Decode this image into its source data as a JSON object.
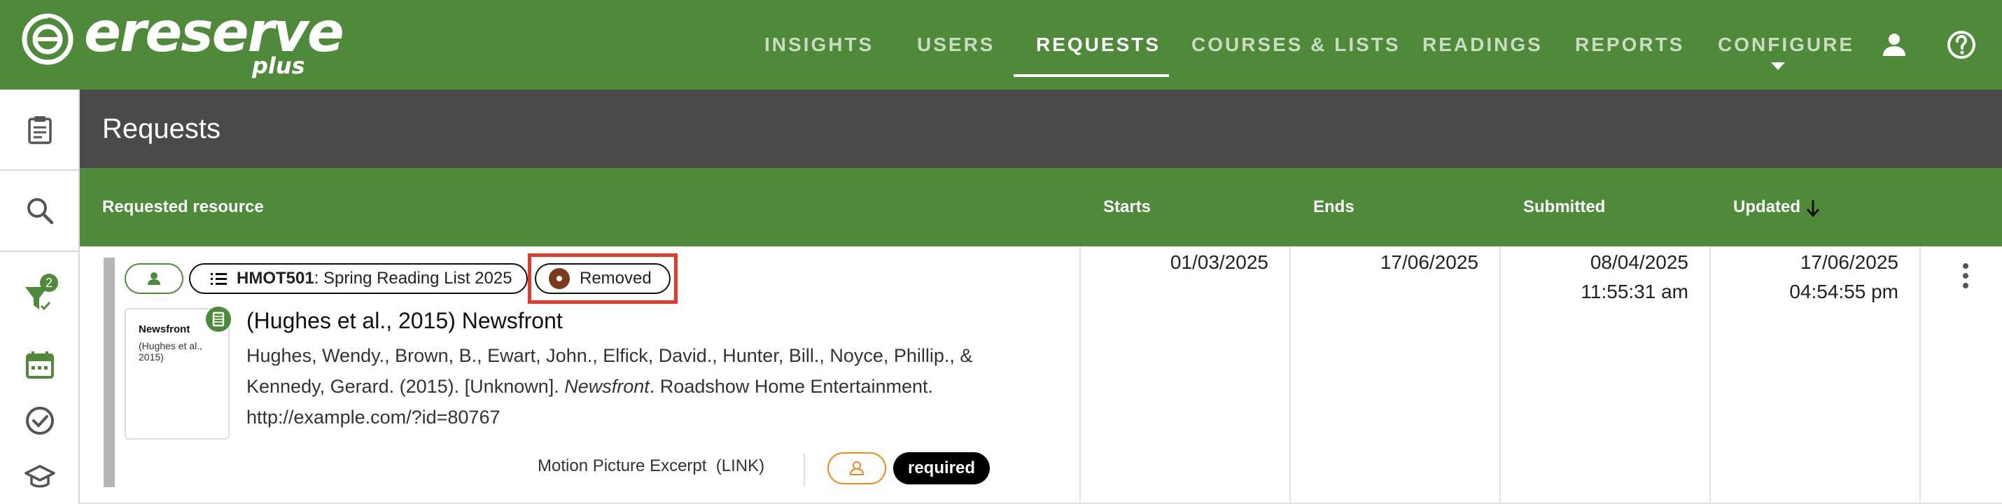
{
  "app": {
    "logo_text": "ereserve",
    "logo_sub": "plus"
  },
  "nav": {
    "items": [
      {
        "label": "INSIGHTS"
      },
      {
        "label": "USERS"
      },
      {
        "label": "REQUESTS",
        "active": true
      },
      {
        "label": "COURSES & LISTS"
      },
      {
        "label": "READINGS"
      },
      {
        "label": "REPORTS"
      },
      {
        "label": "CONFIGURE"
      }
    ],
    "icons": [
      "user-icon",
      "help-icon"
    ]
  },
  "sidebar": {
    "items": [
      {
        "icon": "clipboard-icon"
      },
      {
        "icon": "search-icon"
      },
      {
        "icon": "filter-icon",
        "badge": "2"
      },
      {
        "icon": "calendar-icon"
      },
      {
        "icon": "check-circle-icon"
      },
      {
        "icon": "graduation-cap-icon"
      }
    ]
  },
  "page": {
    "title": "Requests"
  },
  "table": {
    "headers": {
      "resource": "Requested resource",
      "starts": "Starts",
      "ends": "Ends",
      "submitted": "Submitted",
      "updated": "Updated"
    },
    "sort": {
      "column": "updated",
      "direction": "descending"
    },
    "rows": [
      {
        "list_code": "HMOT501",
        "list_name": ": Spring Reading List 2025",
        "status": "Removed",
        "thumb_title": "Newsfront",
        "thumb_sub": "(Hughes et al., 2015)",
        "title": "(Hughes et al., 2015) Newsfront",
        "citation_pre": "Hughes, Wendy., Brown, B., Ewart, John., Elfick, David., Hunter, Bill., Noyce, Phillip., & Kennedy, Gerard. (2015). [Unknown]. ",
        "citation_italic": "Newsfront",
        "citation_post": ". Roadshow Home Entertainment.",
        "url": "http://example.com/?id=80767",
        "resource_type": "Motion Picture Excerpt",
        "link_type": "(LINK)",
        "required_label": "required",
        "starts": "01/03/2025",
        "ends": "17/06/2025",
        "submitted_date": "08/04/2025",
        "submitted_time": "11:55:31 am",
        "updated_date": "17/06/2025",
        "updated_time": "04:54:55 pm"
      }
    ]
  },
  "colors": {
    "brand_green": "#4e8a3a",
    "title_band": "#4a4a4a",
    "highlight": "#e23b2a",
    "orange": "#f08a1c",
    "status_removed": "#7a3b1a"
  }
}
